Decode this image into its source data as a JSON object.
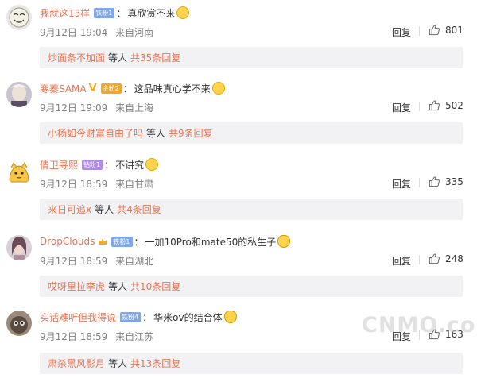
{
  "comments": [
    {
      "username": "我就这13样",
      "badge": "铁粉1",
      "badge_color": "blue",
      "text": "真欣赏不来",
      "emoji": "crying-laughing-emoji",
      "date": "9月12日 19:04",
      "location": "来自河南",
      "reply_label": "回复",
      "likes": "801",
      "sub_user": "炒面条不加面",
      "sub_etc": "等人",
      "sub_count": "共35条回复"
    },
    {
      "username": "寒蓁SAMA",
      "badge": "金粉2",
      "badge_color": "orange",
      "text": "这品味真心学不来",
      "emoji": "smile-emoji",
      "date": "9月12日 19:09",
      "location": "来自上海",
      "reply_label": "回复",
      "likes": "502",
      "sub_user": "小杨如今财富自由了吗",
      "sub_etc": "等人",
      "sub_count": "共9条回复"
    },
    {
      "username": "倩卫寻熙",
      "badge": "钻粉1",
      "badge_color": "purple",
      "text": "不讲究",
      "emoji": "awkward-emoji",
      "date": "9月12日 18:59",
      "location": "来自甘肃",
      "reply_label": "回复",
      "likes": "335",
      "sub_user": "来日可追x",
      "sub_etc": "等人",
      "sub_count": "共4条回复"
    },
    {
      "username": "DropClouds",
      "badge": "铁粉1",
      "badge_color": "blue",
      "text": "一加10Pro和mate50的私生子",
      "emoji": "cat-emoji",
      "date": "9月12日 18:59",
      "location": "来自湖北",
      "reply_label": "回复",
      "likes": "248",
      "sub_user": "哎呀里拉李虎",
      "sub_etc": "等人",
      "sub_count": "共10条回复"
    },
    {
      "username": "实话难听但我得说",
      "badge": "铁粉4",
      "badge_color": "blue",
      "text": "华米ov的结合体",
      "emoji": "cat-emoji",
      "date": "9月12日 18:59",
      "location": "来自江苏",
      "reply_label": "回复",
      "likes": "163",
      "sub_user": "肃杀黑风影月",
      "sub_etc": "等人",
      "sub_count": "共13条回复"
    }
  ],
  "watermark": "CNMO.com"
}
